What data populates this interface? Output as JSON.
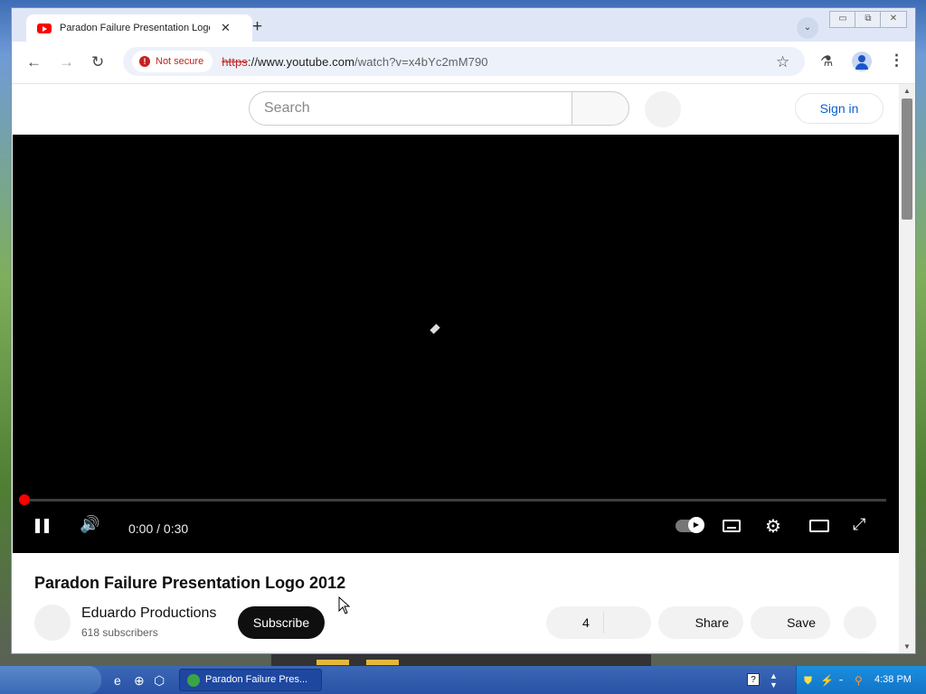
{
  "browser": {
    "tab_title": "Paradon Failure Presentation Logo",
    "tab_close": "✕",
    "new_tab": "+",
    "tab_menu": "⌄",
    "security_label": "Not secure",
    "url_scheme": "https",
    "url_host": "://www.youtube.com",
    "url_path": "/watch?v=x4bYc2mM790",
    "icons": {
      "back": "←",
      "forward": "→",
      "reload": "↻",
      "bookmark": "☆",
      "labs": "⚗",
      "menu": "⋮"
    }
  },
  "window_controls": {
    "minimize": "▭",
    "restore": "⧉",
    "close": "✕"
  },
  "youtube": {
    "search_placeholder": "Search",
    "sign_in": "Sign in",
    "player": {
      "time": "0:00 / 0:30",
      "progress_fraction": 0,
      "volume_icon": "🔊",
      "gear_icon": "⚙",
      "fullscreen_icon": "⤢"
    },
    "video_title": "Paradon Failure Presentation Logo 2012",
    "channel_name": "Eduardo Productions",
    "subscribers": "618 subscribers",
    "subscribe_label": "Subscribe",
    "like_count": "4",
    "share_label": "Share",
    "save_label": "Save"
  },
  "taskbar": {
    "task_label": "Paradon Failure Pres...",
    "clock": "4:38 PM",
    "help": "?",
    "quicklaunch": [
      "e",
      "⊕",
      "⬡"
    ]
  }
}
